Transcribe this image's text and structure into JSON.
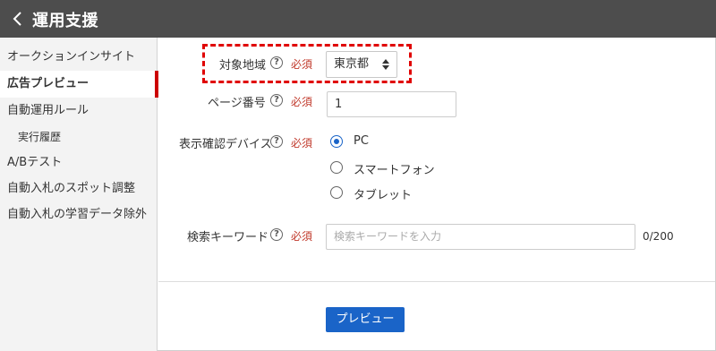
{
  "header": {
    "title": "運用支援",
    "back_icon": "chevron-left-icon"
  },
  "sidebar": {
    "items": [
      {
        "label": "オークションインサイト",
        "active": false,
        "sub": false
      },
      {
        "label": "広告プレビュー",
        "active": true,
        "sub": false
      },
      {
        "label": "自動運用ルール",
        "active": false,
        "sub": false
      },
      {
        "label": "実行履歴",
        "active": false,
        "sub": true
      },
      {
        "label": "A/Bテスト",
        "active": false,
        "sub": false
      },
      {
        "label": "自動入札のスポット調整",
        "active": false,
        "sub": false
      },
      {
        "label": "自動入札の学習データ除外",
        "active": false,
        "sub": false
      }
    ],
    "active_color": "#cc0000"
  },
  "form": {
    "region": {
      "label": "対象地域",
      "required": "必須",
      "value": "東京都"
    },
    "page_number": {
      "label": "ページ番号",
      "required": "必須",
      "value": "1"
    },
    "device": {
      "label": "表示確認デバイス",
      "required": "必須",
      "options": [
        {
          "label": "PC",
          "checked": true
        },
        {
          "label": "スマートフォン",
          "checked": false
        },
        {
          "label": "タブレット",
          "checked": false
        }
      ]
    },
    "keyword": {
      "label": "検索キーワード",
      "required": "必須",
      "placeholder": "検索キーワードを入力",
      "count": "0/200"
    },
    "help_glyph": "?"
  },
  "preview_button": {
    "label": "プレビュー"
  },
  "colors": {
    "header_bg": "#4d4d4d",
    "accent_blue": "#1a64c8",
    "required_red": "#c0392b",
    "highlight_red": "#e00000"
  }
}
